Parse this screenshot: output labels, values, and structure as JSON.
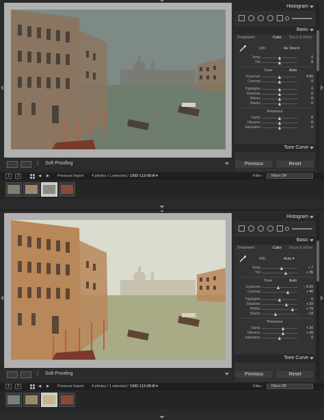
{
  "panes": [
    {
      "id": "before",
      "photo_tone": "cool",
      "panel": {
        "histogram_title": "Histogram",
        "basic_title": "Basic",
        "treatment_label": "Treatment :",
        "treatment_color": "Color",
        "treatment_bw": "Black & White",
        "wb_label": "WB :",
        "wb_value": "As Shot ▾",
        "wb_sliders": [
          {
            "label": "Temp",
            "value": "0",
            "pos": 0.5
          },
          {
            "label": "Tint",
            "value": "0",
            "pos": 0.5
          }
        ],
        "tone_label": "Tone",
        "tone_auto": "Auto",
        "tone_sliders": [
          {
            "label": "Exposure",
            "value": "0.00",
            "pos": 0.5
          },
          {
            "label": "Contrast",
            "value": "0",
            "pos": 0.5
          },
          {
            "label": "Highlights",
            "value": "0",
            "pos": 0.5
          },
          {
            "label": "Shadows",
            "value": "0",
            "pos": 0.5
          },
          {
            "label": "Whites",
            "value": "0",
            "pos": 0.5
          },
          {
            "label": "Blacks",
            "value": "0",
            "pos": 0.5
          }
        ],
        "presence_label": "Presence",
        "presence_sliders": [
          {
            "label": "Clarity",
            "value": "0",
            "pos": 0.5
          },
          {
            "label": "Vibrance",
            "value": "0",
            "pos": 0.5
          },
          {
            "label": "Saturation",
            "value": "0",
            "pos": 0.5
          }
        ],
        "tone_curve_title": "Tone Curve",
        "previous_label": "Previous",
        "reset_label": "Reset"
      },
      "toolbar": {
        "soft_proofing": "Soft Proofing"
      },
      "filmbar": {
        "num1": "1",
        "num2": "2",
        "source": "Previous Import",
        "count": "4 photos / 1 selected /",
        "file": "1992-113-08.tif ▾",
        "filter_label": "Filter :",
        "filter_value": "Filters Off"
      },
      "thumbs_selected": 2
    },
    {
      "id": "after",
      "photo_tone": "warm",
      "panel": {
        "histogram_title": "Histogram",
        "basic_title": "Basic",
        "treatment_label": "Treatment :",
        "treatment_color": "Color",
        "treatment_bw": "Black & White",
        "wb_label": "WB :",
        "wb_value": "Auto ▾",
        "wb_sliders": [
          {
            "label": "Temp",
            "value": "+ 7",
            "pos": 0.56
          },
          {
            "label": "Tint",
            "value": "+ 35",
            "pos": 0.68
          }
        ],
        "tone_label": "Tone",
        "tone_auto": "Auto",
        "tone_sliders": [
          {
            "label": "Exposure",
            "value": "− 0.20",
            "pos": 0.47
          },
          {
            "label": "Contrast",
            "value": "+ 46",
            "pos": 0.73
          },
          {
            "label": "Highlights",
            "value": "0",
            "pos": 0.5
          },
          {
            "label": "Shadows",
            "value": "+ 39",
            "pos": 0.7
          },
          {
            "label": "Whites",
            "value": "+ 79",
            "pos": 0.88
          },
          {
            "label": "Blacks",
            "value": "− 19",
            "pos": 0.4
          }
        ],
        "presence_label": "Presence",
        "presence_sliders": [
          {
            "label": "Clarity",
            "value": "+ 20",
            "pos": 0.6
          },
          {
            "label": "Vibrance",
            "value": "+ 20",
            "pos": 0.6
          },
          {
            "label": "Saturation",
            "value": "0",
            "pos": 0.5
          }
        ],
        "tone_curve_title": "Tone Curve",
        "previous_label": "Previous",
        "reset_label": "Reset"
      },
      "toolbar": {
        "soft_proofing": "Soft Proofing"
      },
      "filmbar": {
        "num1": "1",
        "num2": "2",
        "source": "Previous Import",
        "count": "4 photos / 1 selected /",
        "file": "1992-113-08.tif ▾",
        "filter_label": "Filter :",
        "filter_value": "Filters Off"
      },
      "thumbs_selected": 2
    }
  ],
  "colors": {
    "cool_sky": "#7d8a86",
    "cool_water": "#6f7d6f",
    "cool_building": "#8a7560",
    "warm_sky": "#d9dccf",
    "warm_water": "#a9ab86",
    "warm_building": "#b8875a"
  }
}
